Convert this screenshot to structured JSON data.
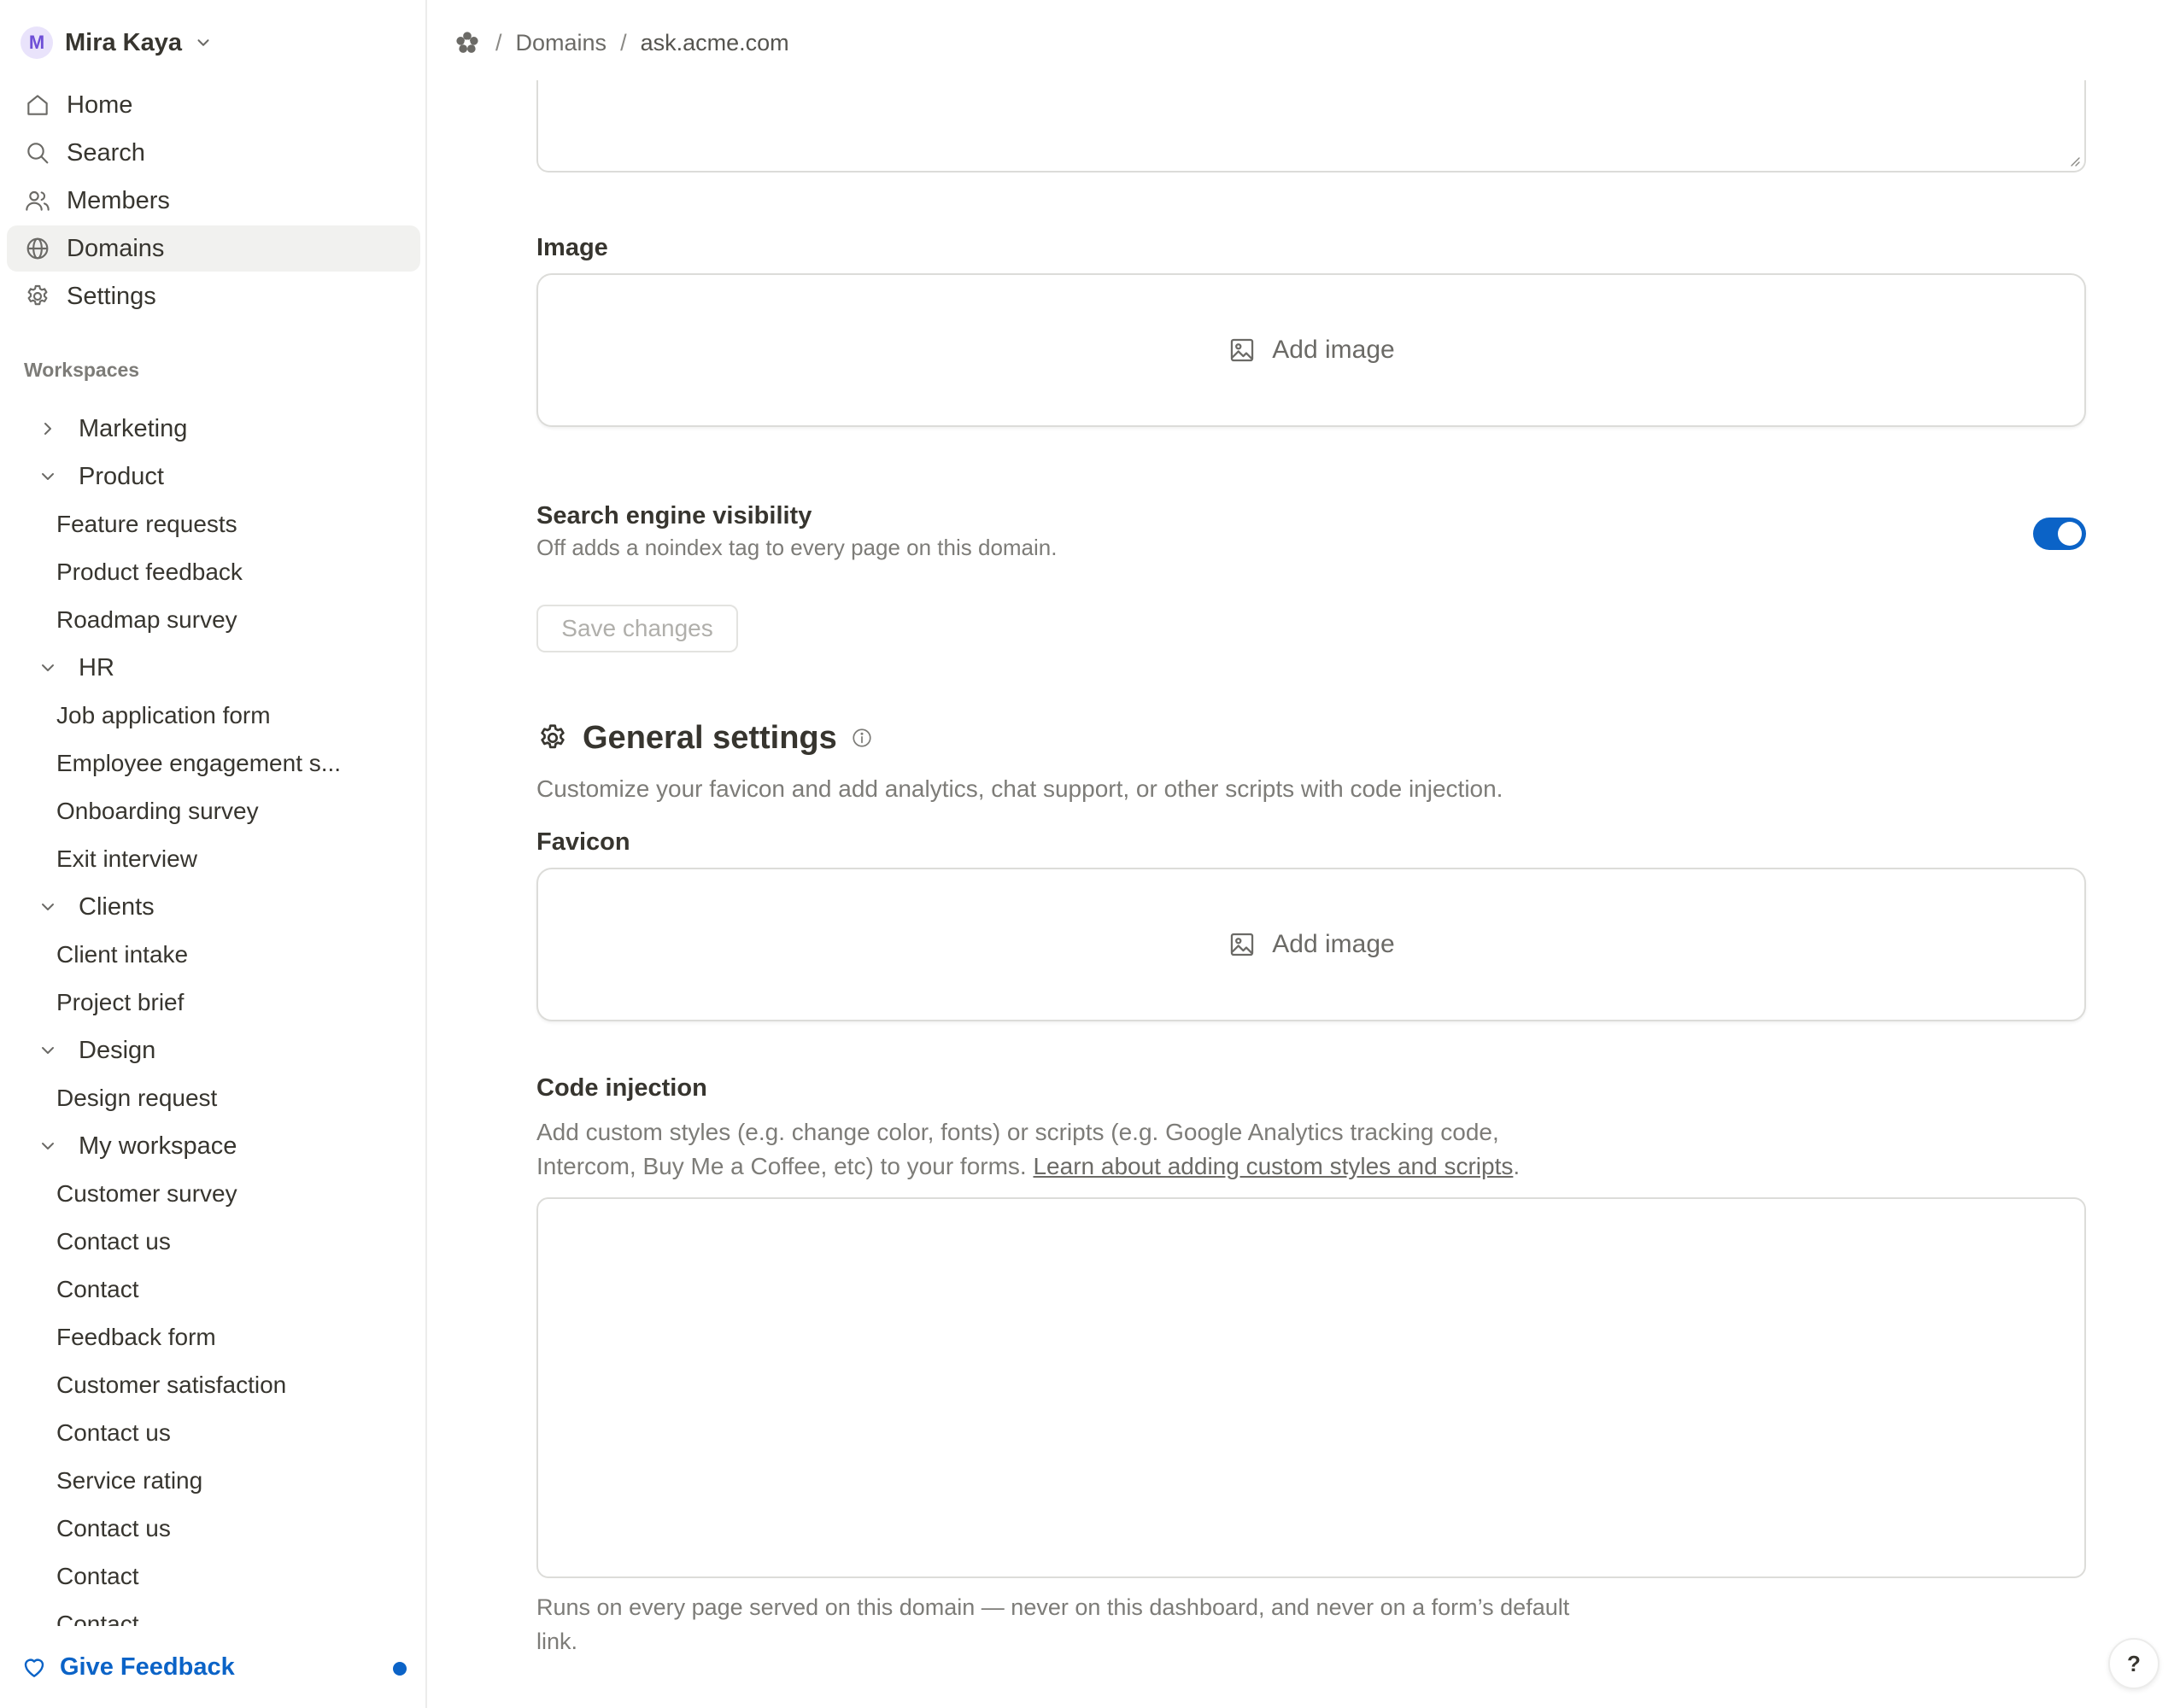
{
  "user": {
    "initial": "M",
    "name": "Mira Kaya"
  },
  "nav": {
    "items": [
      {
        "label": "Home"
      },
      {
        "label": "Search"
      },
      {
        "label": "Members"
      },
      {
        "label": "Domains"
      },
      {
        "label": "Settings"
      }
    ]
  },
  "workspaces": {
    "heading": "Workspaces",
    "rows": [
      "Marketing",
      "Product",
      "Feature requests",
      "Product feedback",
      "Roadmap survey",
      "HR",
      "Job application form",
      "Employee engagement s...",
      "Onboarding survey",
      "Exit interview",
      "Clients",
      "Client intake",
      "Project brief",
      "Design",
      "Design request",
      "My workspace",
      "Customer survey",
      "Contact us",
      "Contact",
      "Feedback form",
      "Customer satisfaction",
      "Contact us",
      "Service rating",
      "Contact us",
      "Contact",
      "Contact"
    ]
  },
  "feedback": {
    "label": "Give Feedback"
  },
  "breadcrumb": {
    "sep": "/",
    "domains": "Domains",
    "current": "ask.acme.com"
  },
  "image_field": {
    "label": "Image",
    "upload": "Add image"
  },
  "seo": {
    "title": "Search engine visibility",
    "description": "Off adds a noindex tag to every page on this domain.",
    "enabled": true
  },
  "save": {
    "label": "Save changes"
  },
  "general": {
    "title": "General settings",
    "description": "Customize your favicon and add analytics, chat support, or other scripts with code injection."
  },
  "favicon": {
    "label": "Favicon",
    "upload": "Add image"
  },
  "code_injection": {
    "label": "Code injection",
    "description": "Add custom styles (e.g. change color, fonts) or scripts (e.g. Google Analytics tracking code, Intercom, Buy Me a Coffee, etc) to your forms.",
    "link": "Learn about adding custom styles and scripts",
    "link_suffix": ".",
    "value": "",
    "footnote": "Runs on every page served on this domain — never on this dashboard, and never on a form’s default link."
  },
  "help": {
    "label": "?"
  }
}
